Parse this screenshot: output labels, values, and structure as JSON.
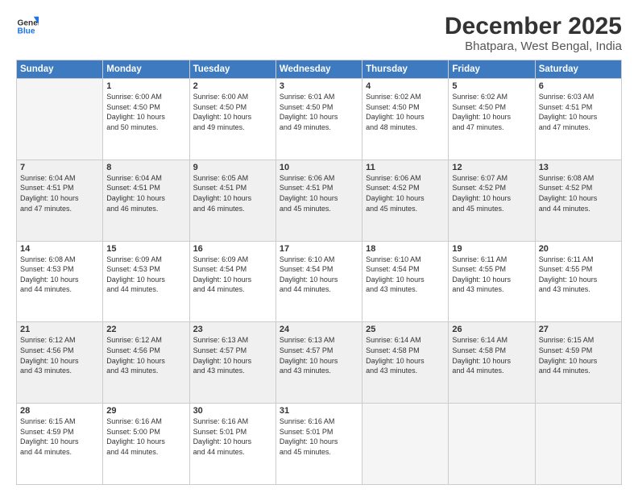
{
  "logo": {
    "line1": "General",
    "line2": "Blue"
  },
  "header": {
    "title": "December 2025",
    "subtitle": "Bhatpara, West Bengal, India"
  },
  "weekdays": [
    "Sunday",
    "Monday",
    "Tuesday",
    "Wednesday",
    "Thursday",
    "Friday",
    "Saturday"
  ],
  "weeks": [
    [
      {
        "day": "",
        "info": ""
      },
      {
        "day": "1",
        "info": "Sunrise: 6:00 AM\nSunset: 4:50 PM\nDaylight: 10 hours\nand 50 minutes."
      },
      {
        "day": "2",
        "info": "Sunrise: 6:00 AM\nSunset: 4:50 PM\nDaylight: 10 hours\nand 49 minutes."
      },
      {
        "day": "3",
        "info": "Sunrise: 6:01 AM\nSunset: 4:50 PM\nDaylight: 10 hours\nand 49 minutes."
      },
      {
        "day": "4",
        "info": "Sunrise: 6:02 AM\nSunset: 4:50 PM\nDaylight: 10 hours\nand 48 minutes."
      },
      {
        "day": "5",
        "info": "Sunrise: 6:02 AM\nSunset: 4:50 PM\nDaylight: 10 hours\nand 47 minutes."
      },
      {
        "day": "6",
        "info": "Sunrise: 6:03 AM\nSunset: 4:51 PM\nDaylight: 10 hours\nand 47 minutes."
      }
    ],
    [
      {
        "day": "7",
        "info": "Sunrise: 6:04 AM\nSunset: 4:51 PM\nDaylight: 10 hours\nand 47 minutes."
      },
      {
        "day": "8",
        "info": "Sunrise: 6:04 AM\nSunset: 4:51 PM\nDaylight: 10 hours\nand 46 minutes."
      },
      {
        "day": "9",
        "info": "Sunrise: 6:05 AM\nSunset: 4:51 PM\nDaylight: 10 hours\nand 46 minutes."
      },
      {
        "day": "10",
        "info": "Sunrise: 6:06 AM\nSunset: 4:51 PM\nDaylight: 10 hours\nand 45 minutes."
      },
      {
        "day": "11",
        "info": "Sunrise: 6:06 AM\nSunset: 4:52 PM\nDaylight: 10 hours\nand 45 minutes."
      },
      {
        "day": "12",
        "info": "Sunrise: 6:07 AM\nSunset: 4:52 PM\nDaylight: 10 hours\nand 45 minutes."
      },
      {
        "day": "13",
        "info": "Sunrise: 6:08 AM\nSunset: 4:52 PM\nDaylight: 10 hours\nand 44 minutes."
      }
    ],
    [
      {
        "day": "14",
        "info": "Sunrise: 6:08 AM\nSunset: 4:53 PM\nDaylight: 10 hours\nand 44 minutes."
      },
      {
        "day": "15",
        "info": "Sunrise: 6:09 AM\nSunset: 4:53 PM\nDaylight: 10 hours\nand 44 minutes."
      },
      {
        "day": "16",
        "info": "Sunrise: 6:09 AM\nSunset: 4:54 PM\nDaylight: 10 hours\nand 44 minutes."
      },
      {
        "day": "17",
        "info": "Sunrise: 6:10 AM\nSunset: 4:54 PM\nDaylight: 10 hours\nand 44 minutes."
      },
      {
        "day": "18",
        "info": "Sunrise: 6:10 AM\nSunset: 4:54 PM\nDaylight: 10 hours\nand 43 minutes."
      },
      {
        "day": "19",
        "info": "Sunrise: 6:11 AM\nSunset: 4:55 PM\nDaylight: 10 hours\nand 43 minutes."
      },
      {
        "day": "20",
        "info": "Sunrise: 6:11 AM\nSunset: 4:55 PM\nDaylight: 10 hours\nand 43 minutes."
      }
    ],
    [
      {
        "day": "21",
        "info": "Sunrise: 6:12 AM\nSunset: 4:56 PM\nDaylight: 10 hours\nand 43 minutes."
      },
      {
        "day": "22",
        "info": "Sunrise: 6:12 AM\nSunset: 4:56 PM\nDaylight: 10 hours\nand 43 minutes."
      },
      {
        "day": "23",
        "info": "Sunrise: 6:13 AM\nSunset: 4:57 PM\nDaylight: 10 hours\nand 43 minutes."
      },
      {
        "day": "24",
        "info": "Sunrise: 6:13 AM\nSunset: 4:57 PM\nDaylight: 10 hours\nand 43 minutes."
      },
      {
        "day": "25",
        "info": "Sunrise: 6:14 AM\nSunset: 4:58 PM\nDaylight: 10 hours\nand 43 minutes."
      },
      {
        "day": "26",
        "info": "Sunrise: 6:14 AM\nSunset: 4:58 PM\nDaylight: 10 hours\nand 44 minutes."
      },
      {
        "day": "27",
        "info": "Sunrise: 6:15 AM\nSunset: 4:59 PM\nDaylight: 10 hours\nand 44 minutes."
      }
    ],
    [
      {
        "day": "28",
        "info": "Sunrise: 6:15 AM\nSunset: 4:59 PM\nDaylight: 10 hours\nand 44 minutes."
      },
      {
        "day": "29",
        "info": "Sunrise: 6:16 AM\nSunset: 5:00 PM\nDaylight: 10 hours\nand 44 minutes."
      },
      {
        "day": "30",
        "info": "Sunrise: 6:16 AM\nSunset: 5:01 PM\nDaylight: 10 hours\nand 44 minutes."
      },
      {
        "day": "31",
        "info": "Sunrise: 6:16 AM\nSunset: 5:01 PM\nDaylight: 10 hours\nand 45 minutes."
      },
      {
        "day": "",
        "info": ""
      },
      {
        "day": "",
        "info": ""
      },
      {
        "day": "",
        "info": ""
      }
    ]
  ]
}
